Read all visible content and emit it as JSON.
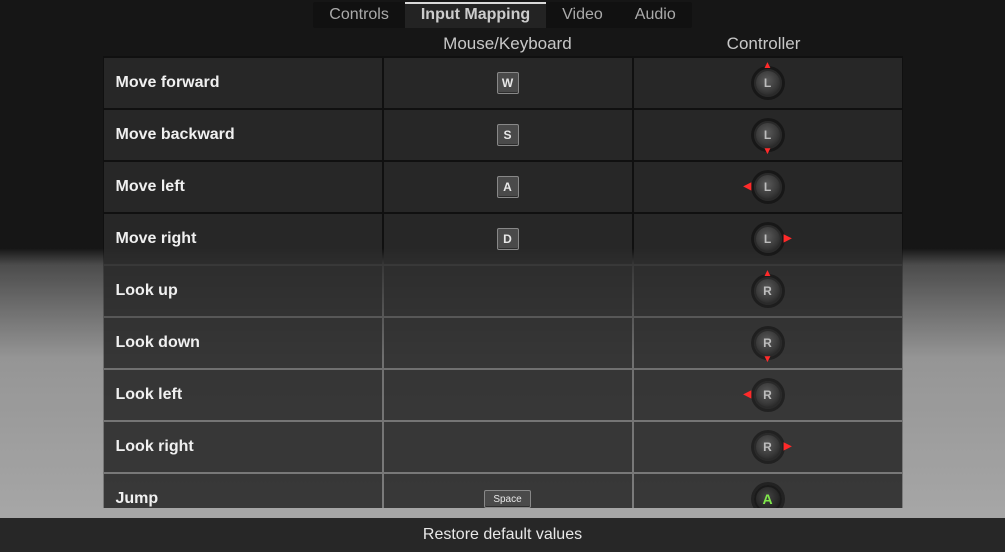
{
  "tabs": {
    "controls": "Controls",
    "input_mapping": "Input Mapping",
    "video": "Video",
    "audio": "Audio",
    "active": "input_mapping"
  },
  "columns": {
    "action": "",
    "kb": "Mouse/Keyboard",
    "ctrl": "Controller"
  },
  "bindings": [
    {
      "action": "Move forward",
      "kb": "W",
      "stick": "L",
      "dir": "up"
    },
    {
      "action": "Move backward",
      "kb": "S",
      "stick": "L",
      "dir": "down"
    },
    {
      "action": "Move left",
      "kb": "A",
      "stick": "L",
      "dir": "left"
    },
    {
      "action": "Move right",
      "kb": "D",
      "stick": "L",
      "dir": "right"
    },
    {
      "action": "Look up",
      "kb": "",
      "stick": "R",
      "dir": "up"
    },
    {
      "action": "Look down",
      "kb": "",
      "stick": "R",
      "dir": "down"
    },
    {
      "action": "Look left",
      "kb": "",
      "stick": "R",
      "dir": "left"
    },
    {
      "action": "Look right",
      "kb": "",
      "stick": "R",
      "dir": "right"
    },
    {
      "action": "Jump",
      "kb": "Space",
      "button": "A"
    }
  ],
  "footer": {
    "restore": "Restore default values"
  }
}
